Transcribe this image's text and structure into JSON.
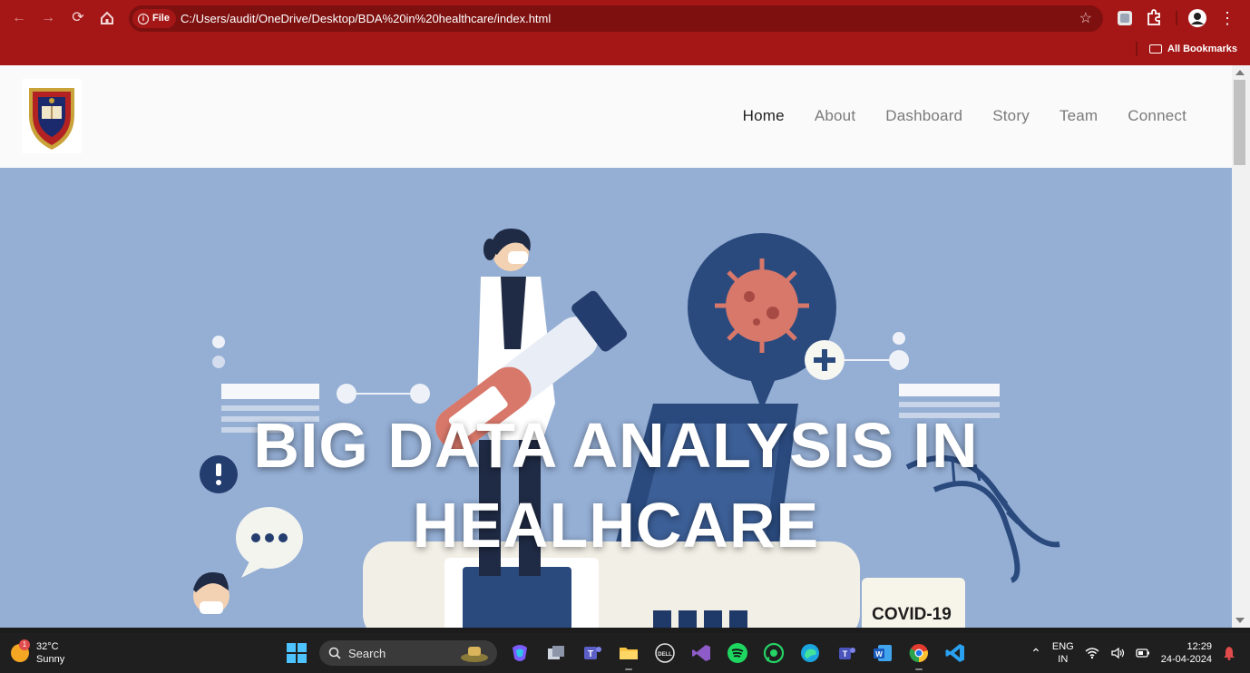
{
  "browser": {
    "site_chip": "File",
    "url": "C:/Users/audit/OneDrive/Desktop/BDA%20in%20healthcare/index.html",
    "bookmarks_label": "All Bookmarks",
    "theme_color": "#a51717"
  },
  "site": {
    "nav": [
      {
        "label": "Home",
        "active": true
      },
      {
        "label": "About"
      },
      {
        "label": "Dashboard"
      },
      {
        "label": "Story"
      },
      {
        "label": "Team"
      },
      {
        "label": "Connect"
      }
    ],
    "hero": {
      "title_line1": "BIG DATA ANALYSIS IN",
      "title_line2": "HEALHCARE",
      "badge_text": "COVID-19",
      "background_color": "#94aed4"
    }
  },
  "taskbar": {
    "weather": {
      "temp": "32°C",
      "condition": "Sunny",
      "badge": "1"
    },
    "search_placeholder": "Search",
    "language": {
      "line1": "ENG",
      "line2": "IN"
    },
    "clock": {
      "time": "12:29",
      "date": "24-04-2024"
    },
    "apps": [
      "start-icon",
      "search-box",
      "copilot-icon",
      "task-view-icon",
      "teams-icon",
      "file-explorer-icon",
      "dell-icon",
      "visual-studio-icon",
      "spotify-icon",
      "whatsapp-icon",
      "edge-icon",
      "teams-work-icon",
      "word-icon",
      "chrome-icon",
      "vscode-icon"
    ]
  }
}
